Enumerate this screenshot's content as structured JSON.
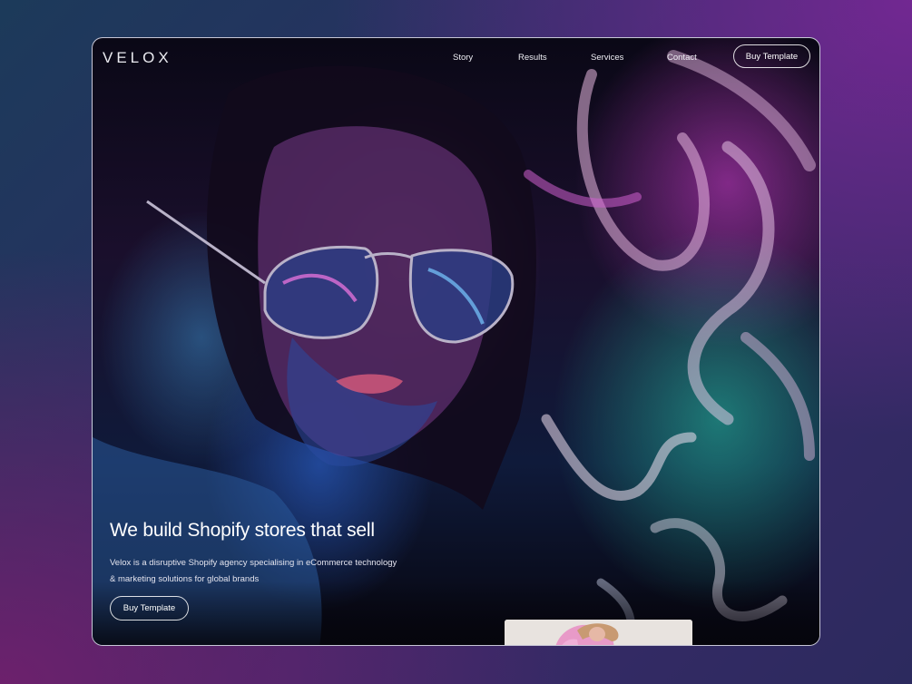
{
  "brand": {
    "logo": "VELOX"
  },
  "nav": {
    "links": [
      {
        "label": "Story"
      },
      {
        "label": "Results"
      },
      {
        "label": "Services"
      },
      {
        "label": "Contact"
      }
    ],
    "cta_label": "Buy Template"
  },
  "hero": {
    "title": "We build Shopify stores that sell",
    "subtitle_line1": "Velox is a disruptive Shopify agency specialising in eCommerce technology",
    "subtitle_line2": "& marketing solutions for global brands",
    "cta_label": "Buy Template"
  },
  "colors": {
    "accent_pink": "#e06cc8",
    "accent_teal": "#2fd0b0",
    "accent_blue": "#3a6fd0",
    "text_primary": "#ffffff"
  }
}
